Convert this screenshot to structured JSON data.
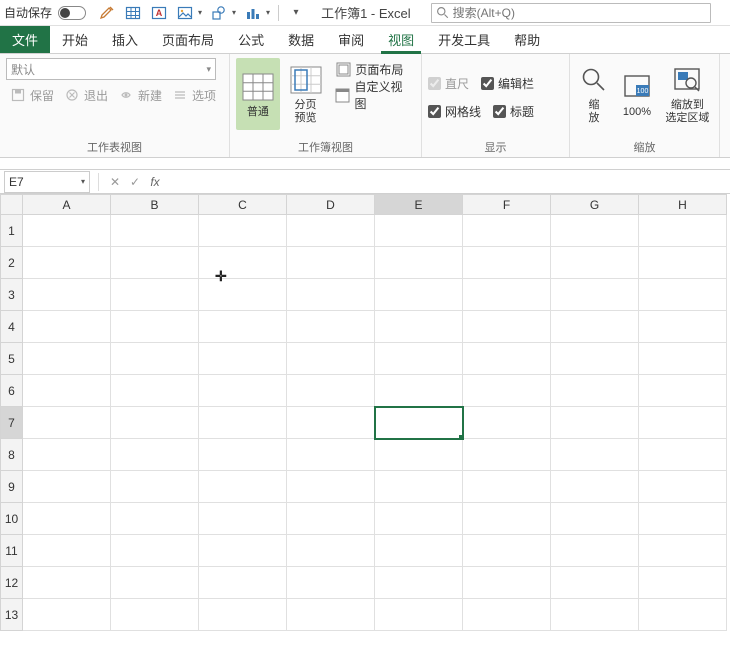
{
  "titlebar": {
    "autosave_label": "自动保存",
    "doc_title": "工作簿1 - Excel",
    "search_placeholder": "搜索(Alt+Q)"
  },
  "tabs": {
    "file": "文件",
    "items": [
      "开始",
      "插入",
      "页面布局",
      "公式",
      "数据",
      "审阅",
      "视图",
      "开发工具",
      "帮助"
    ],
    "active_index": 6
  },
  "ribbon": {
    "sheetview": {
      "title": "工作表视图",
      "combo_placeholder": "默认",
      "keep": "保留",
      "exit": "退出",
      "new": "新建",
      "options": "选项"
    },
    "workbookview": {
      "title": "工作簿视图",
      "normal": "普通",
      "pagebreak": "分页\n预览",
      "pagelayout": "页面布局",
      "custom": "自定义视图"
    },
    "show": {
      "title": "显示",
      "ruler": "直尺",
      "formula_bar": "编辑栏",
      "gridlines": "网格线",
      "headings": "标题"
    },
    "zoom": {
      "title": "缩放",
      "zoom": "缩\n放",
      "hundred": "100%",
      "to_selection": "缩放到\n选定区域"
    }
  },
  "formula_bar": {
    "namebox": "E7",
    "fx_label": "fx",
    "value": ""
  },
  "grid": {
    "columns": [
      "A",
      "B",
      "C",
      "D",
      "E",
      "F",
      "G",
      "H"
    ],
    "rows": [
      1,
      2,
      3,
      4,
      5,
      6,
      7,
      8,
      9,
      10,
      11,
      12,
      13
    ],
    "active_col": "E",
    "active_row": 7
  },
  "icons": {
    "search": "search-icon",
    "pen": "brush-icon",
    "table": "table-icon",
    "textbox": "textbox-icon",
    "image": "image-icon",
    "shapes": "shapes-icon",
    "chart": "chart-icon"
  }
}
